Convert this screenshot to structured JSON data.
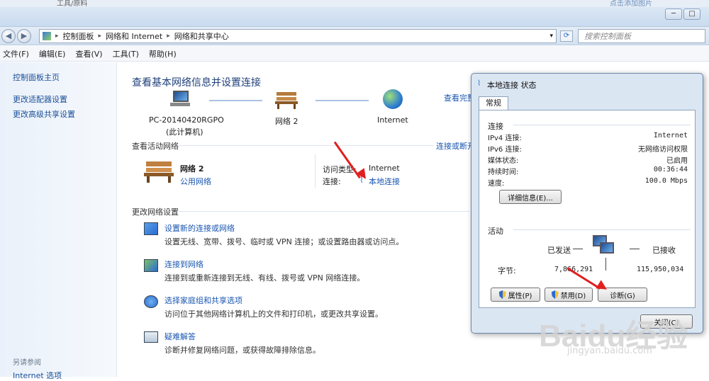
{
  "background_app": {
    "left_text": "工具/原料",
    "right_text": "点击添加图片"
  },
  "window": {
    "minimize": "─",
    "maximize": "□"
  },
  "addressbar": {
    "back": "◀",
    "forward": "▶",
    "crumbs": [
      "控制面板",
      "网络和 Internet",
      "网络和共享中心"
    ],
    "search_placeholder": "搜索控制面板"
  },
  "menu": [
    "文件(F)",
    "编辑(E)",
    "查看(V)",
    "工具(T)",
    "帮助(H)"
  ],
  "leftnav": {
    "items": [
      "控制面板主页",
      "更改适配器设置",
      "更改高级共享设置"
    ],
    "see_also_heading": "另请参阅",
    "see_also": [
      "Internet 选项"
    ]
  },
  "main": {
    "title": "查看基本网络信息并设置连接",
    "see_full_map": "查看完整",
    "nodes": [
      {
        "name": "PC-20140420RGPO",
        "sub": "(此计算机)"
      },
      {
        "name": "网络  2",
        "sub": ""
      },
      {
        "name": "Internet",
        "sub": ""
      }
    ],
    "active_heading": "查看活动网络",
    "connect_link": "连接或断开",
    "network_name": "网络  2",
    "network_type": "公用网络",
    "access_type_label": "访问类型:",
    "access_type_value": "Internet",
    "connection_label": "连接:",
    "connection_value": "本地连接",
    "change_heading": "更改网络设置",
    "tasks": [
      {
        "title": "设置新的连接或网络",
        "desc": "设置无线、宽带、拨号、临时或 VPN 连接；或设置路由器或访问点。"
      },
      {
        "title": "连接到网络",
        "desc": "连接到或重新连接到无线、有线、拨号或 VPN 网络连接。"
      },
      {
        "title": "选择家庭组和共享选项",
        "desc": "访问位于其他网络计算机上的文件和打印机，或更改共享设置。"
      },
      {
        "title": "疑难解答",
        "desc": "诊断并修复网络问题，或获得故障排除信息。"
      }
    ]
  },
  "dialog": {
    "title": "本地连接 状态",
    "tab": "常规",
    "connection_heading": "连接",
    "rows": [
      {
        "key": "IPv4 连接:",
        "value": "Internet"
      },
      {
        "key": "IPv6 连接:",
        "value": "无网络访问权限"
      },
      {
        "key": "媒体状态:",
        "value": "已启用"
      },
      {
        "key": "持续时间:",
        "value": "00:36:44"
      },
      {
        "key": "速度:",
        "value": "100.0 Mbps"
      }
    ],
    "details_button": "详细信息(E)...",
    "activity_heading": "活动",
    "sent_label": "已发送",
    "received_label": "已接收",
    "bytes_label": "字节:",
    "bytes_sent": "7,866,291",
    "bytes_received": "115,950,034",
    "properties_button": "属性(P)",
    "disable_button": "禁用(D)",
    "diagnose_button": "诊断(G)",
    "close_button": "关闭(C)"
  },
  "watermark": {
    "brand": "Baidu经验",
    "url": "jingyan.baidu.com"
  },
  "colors": {
    "link": "#1a56b0",
    "title": "#1e3f7a",
    "annotation_arrow": "#e02020"
  }
}
